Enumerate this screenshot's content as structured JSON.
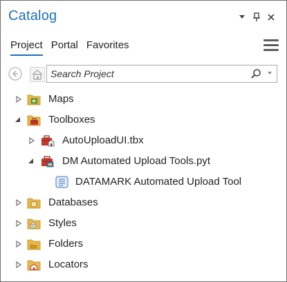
{
  "pane": {
    "title": "Catalog",
    "title_icons": [
      "chevron-down-icon",
      "pin-icon",
      "close-icon"
    ]
  },
  "tabs": [
    {
      "label": "Project",
      "active": true
    },
    {
      "label": "Portal",
      "active": false
    },
    {
      "label": "Favorites",
      "active": false
    }
  ],
  "search": {
    "placeholder": "Search Project",
    "value": ""
  },
  "tree": {
    "maps": {
      "label": "Maps",
      "icon": "maps-folder-icon",
      "expanded": false
    },
    "toolboxes": {
      "label": "Toolboxes",
      "icon": "toolboxes-folder-icon",
      "expanded": true
    },
    "autoupload_tbx": {
      "label": "AutoUploadUI.tbx",
      "icon": "toolbox-icon",
      "expanded": false
    },
    "dm_pyt": {
      "label": "DM Automated Upload Tools.pyt",
      "icon": "python-toolbox-icon",
      "expanded": true
    },
    "datamark_tool": {
      "label": "DATAMARK Automated Upload Tool",
      "icon": "script-tool-icon"
    },
    "databases": {
      "label": "Databases",
      "icon": "databases-folder-icon",
      "expanded": false
    },
    "styles": {
      "label": "Styles",
      "icon": "styles-folder-icon",
      "expanded": false
    },
    "folders": {
      "label": "Folders",
      "icon": "folders-folder-icon",
      "expanded": false
    },
    "locators": {
      "label": "Locators",
      "icon": "locators-folder-icon",
      "expanded": false
    }
  },
  "colors": {
    "accent": "#1d70b8",
    "folder": "#e8b84a",
    "toolbox_red": "#c8382b",
    "text": "#222222"
  }
}
